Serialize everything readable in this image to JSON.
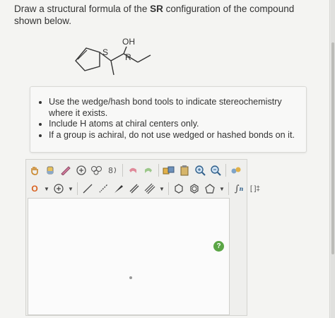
{
  "question": {
    "prefix": "Draw a structural formula of the ",
    "bold": "SR",
    "suffix": " configuration of the compound shown below."
  },
  "molecule": {
    "labels": {
      "oh": "OH",
      "s": "S",
      "r": "R"
    }
  },
  "instructions": [
    "Use the wedge/hash bond tools to indicate stereochemistry where it exists.",
    "Include H atoms at chiral centers only.",
    "If a group is achiral, do not use wedged or hashed bonds on it."
  ],
  "editor": {
    "element_selector": "O",
    "sn_label": "n",
    "bracket_label": "[ ]‡",
    "help_label": "?"
  },
  "colors": {
    "help_green": "#5aa545",
    "accent_orange": "#d9601e"
  },
  "icons": {
    "row1": [
      "hand-icon",
      "eraser-icon",
      "pencil-icon",
      "atom-map-icon",
      "charge-icon",
      "rotate-icon",
      "undo-icon",
      "redo-icon",
      "template-icon",
      "clipboard-icon",
      "zoom-in-icon",
      "zoom-out-icon",
      "settings-icon"
    ],
    "row2": [
      "element-o-icon",
      "dropdown-icon",
      "charge-plus-icon",
      "dropdown-icon",
      "single-bond-icon",
      "hash-bond-icon",
      "wedge-bond-icon",
      "double-bond-icon",
      "triple-bond-icon",
      "dropdown-icon",
      "hexagon-icon",
      "benzene-icon",
      "pentagon-icon",
      "dropdown-icon",
      "sn-icon",
      "bracket-icon"
    ]
  }
}
